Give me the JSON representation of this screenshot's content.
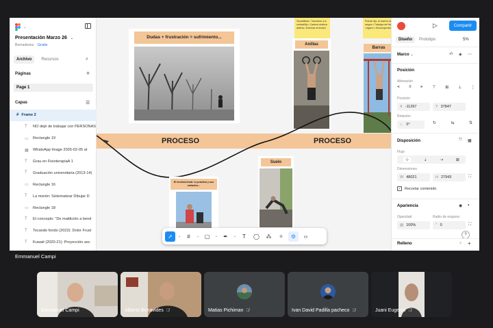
{
  "app": {
    "doc_title": "Presentación Marzo 26",
    "doc_drafts": "Borradores",
    "doc_plan": "Gratis",
    "tab_file": "Archivo",
    "tab_assets": "Recursos",
    "pages_label": "Páginas",
    "page_1": "Page 1",
    "layers_label": "Capas",
    "layers": [
      {
        "type": "frame",
        "name": "Frame 2"
      },
      {
        "type": "text",
        "name": "NO dejé de trabajar con PERSONAS"
      },
      {
        "type": "rect",
        "name": "Rectangle 19"
      },
      {
        "type": "image",
        "name": "WhatsApp Image 2026-02-05 at"
      },
      {
        "type": "text",
        "name": "Grau en FisioterapiaA 1"
      },
      {
        "type": "text",
        "name": "Graduación universitaria (2013-14)"
      },
      {
        "type": "rect",
        "name": "Rectangle 16"
      },
      {
        "type": "text",
        "name": "La misión: Sistematizar Dibujar D"
      },
      {
        "type": "rect",
        "name": "Rectangle 18"
      },
      {
        "type": "text",
        "name": "El concepto: \"De maldición a bend"
      },
      {
        "type": "text",
        "name": "Tocando fondo (2022): Dolor Frust"
      },
      {
        "type": "text",
        "name": "Kuwait (2020-21): Proyección asc"
      }
    ]
  },
  "canvas": {
    "title_card": "Dudas + frustración = sufrimiento...",
    "banner_left": "PROCESO",
    "banner_right": "PROCESO",
    "label_anillas": "Anillas",
    "label_barras": "Barras",
    "label_suelo": "Suelo",
    "label_small": "El tendón/rehab: La práctica y sus variantes...",
    "sticky_1": "Versatilidad • Transición a lo vertical/fijo • Cadena cinética abierta • Estímulo al tendón",
    "sticky_2": "Pulsión fija, la reserva de rangos • Trabajos del fisio • Agarre • Descompresión"
  },
  "right": {
    "share_label": "Compartir",
    "tab_design": "Diseño",
    "tab_prototype": "Prototipo",
    "zoom": "5%",
    "element_name": "Marco",
    "position_label": "Posición",
    "alignment_label": "Alineación",
    "pos_label": "Posición",
    "x_value": "-11297",
    "y_value": "37847",
    "rotation_label": "Rotación",
    "rotation_value": "0°",
    "layout_label": "Disposición",
    "flow_label": "Flujo",
    "dimensions_label": "Dimensiones",
    "w_value": "48021",
    "h_value": "27943",
    "clip_label": "Recortar contenido",
    "appearance_label": "Apariencia",
    "opacity_label": "Opacidad",
    "opacity_value": "100%",
    "radius_label": "Radio de esquina",
    "radius_value": "0",
    "fill_label": "Relleno",
    "help": "?"
  },
  "meeting": {
    "presenter": "Emmanuel Campi",
    "participants": [
      {
        "name": "Emmanuel Campi",
        "muted": false
      },
      {
        "name": "Alberto Benavides",
        "muted": true
      },
      {
        "name": "Matias Pichiman",
        "muted": true
      },
      {
        "name": "Ivan David Padilla pacheco",
        "muted": true
      },
      {
        "name": "Juani Eugenio",
        "muted": true
      }
    ]
  },
  "colors": {
    "accent": "#1b8cf2",
    "banner": "#f3c597",
    "sticky": "#fbe87a",
    "tile_bg": "#3c4043"
  }
}
